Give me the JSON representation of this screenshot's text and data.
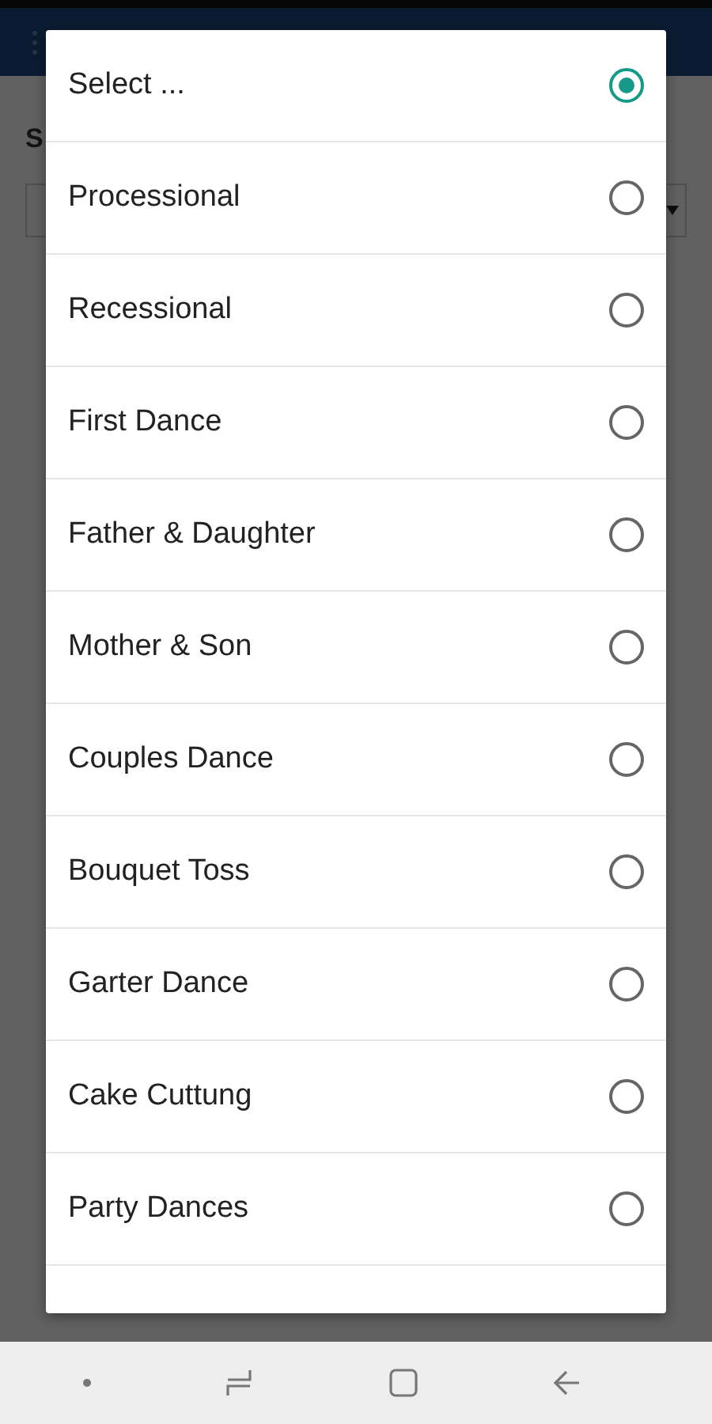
{
  "background": {
    "label": "S"
  },
  "dialog": {
    "options": [
      {
        "label": "Select ...",
        "selected": true
      },
      {
        "label": "Processional",
        "selected": false
      },
      {
        "label": "Recessional",
        "selected": false
      },
      {
        "label": "First Dance",
        "selected": false
      },
      {
        "label": "Father & Daughter",
        "selected": false
      },
      {
        "label": "Mother & Son",
        "selected": false
      },
      {
        "label": "Couples Dance",
        "selected": false
      },
      {
        "label": "Bouquet Toss",
        "selected": false
      },
      {
        "label": "Garter Dance",
        "selected": false
      },
      {
        "label": "Cake Cuttung",
        "selected": false
      },
      {
        "label": "Party Dances",
        "selected": false
      }
    ]
  }
}
